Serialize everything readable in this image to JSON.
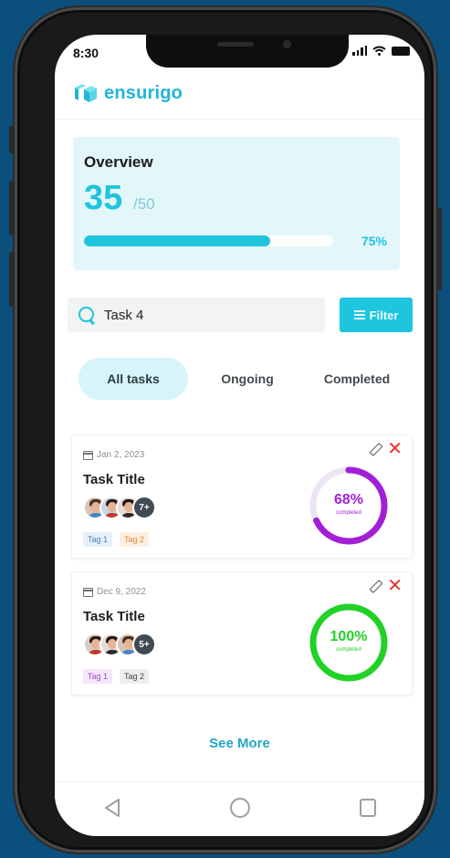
{
  "status_bar": {
    "time": "8:30"
  },
  "brand": {
    "name": "ensurigo",
    "color": "#1fb6d6"
  },
  "overview": {
    "title": "Overview",
    "completed": "35",
    "total": "/50",
    "progress": 0.75,
    "progress_label": "75%"
  },
  "search": {
    "value": "Task 4",
    "icon": "search-icon"
  },
  "filter": {
    "label": "Filter",
    "icon": "filter-icon"
  },
  "tabs": [
    {
      "label": "All tasks",
      "active": true
    },
    {
      "label": "Ongoing",
      "active": false
    },
    {
      "label": "Completed",
      "active": false
    }
  ],
  "tasks": [
    {
      "date": "Jan 2, 2023",
      "title": "Task Title",
      "more_count": "7+",
      "tags": [
        "Tag 1",
        "Tag 2"
      ],
      "percent": 0.68,
      "percent_label": "68%",
      "status_label": "completed",
      "ring_color": "#a21fd8"
    },
    {
      "date": "Dec 9, 2022",
      "title": "Task Title",
      "more_count": "5+",
      "tags": [
        "Tag 1",
        "Tag 2"
      ],
      "percent": 1.0,
      "percent_label": "100%",
      "status_label": "completed",
      "ring_color": "#22d126"
    }
  ],
  "see_more": "See More",
  "nav": {
    "back_icon": "back-triangle-icon",
    "home_icon": "home-circle-icon",
    "recents_icon": "recents-square-icon"
  }
}
